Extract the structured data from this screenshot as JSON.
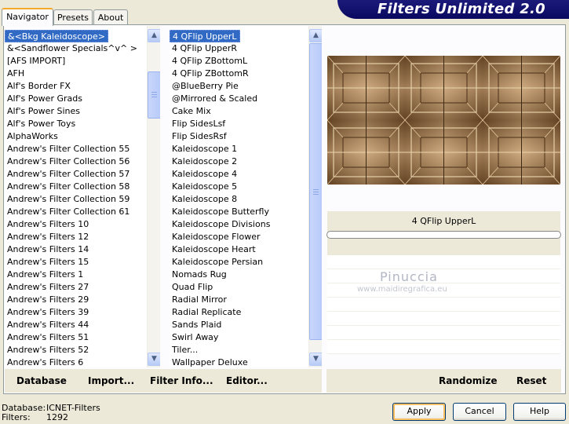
{
  "tabs": [
    "Navigator",
    "Presets",
    "About"
  ],
  "banner_title": "Filters Unlimited 2.0",
  "categories": [
    "&<Bkg Kaleidoscope>",
    "&<Sandflower Specials^v^ >",
    "[AFS IMPORT]",
    "AFH",
    "Alf's Border FX",
    "Alf's Power Grads",
    "Alf's Power Sines",
    "Alf's Power Toys",
    "AlphaWorks",
    "Andrew's Filter Collection 55",
    "Andrew's Filter Collection 56",
    "Andrew's Filter Collection 57",
    "Andrew's Filter Collection 58",
    "Andrew's Filter Collection 59",
    "Andrew's Filter Collection 61",
    "Andrew's Filters 10",
    "Andrew's Filters 12",
    "Andrew's Filters 14",
    "Andrew's Filters 15",
    "Andrew's Filters 1",
    "Andrew's Filters 27",
    "Andrew's Filters 29",
    "Andrew's Filters 39",
    "Andrew's Filters 44",
    "Andrew's Filters 51",
    "Andrew's Filters 52",
    "Andrew's Filters 6"
  ],
  "filters": [
    "4 QFlip UpperL",
    "4 QFlip UpperR",
    "4 QFlip ZBottomL",
    "4 QFlip ZBottomR",
    "@BlueBerry Pie",
    "@Mirrored & Scaled",
    "Cake Mix",
    "Flip SidesLsf",
    "Flip SidesRsf",
    "Kaleidoscope 1",
    "Kaleidoscope 2",
    "Kaleidoscope 4",
    "Kaleidoscope 5",
    "Kaleidoscope 8",
    "Kaleidoscope Butterfly",
    "Kaleidoscope Divisions",
    "Kaleidoscope Flower",
    "Kaleidoscope Heart",
    "Kaleidoscope Persian",
    "Nomads Rug",
    "Quad Flip",
    "Radial Mirror",
    "Radial Replicate",
    "Sands Plaid",
    "Swirl Away",
    "Tiler...",
    "Wallpaper Deluxe"
  ],
  "links": {
    "database": "Database",
    "import": "Import...",
    "filter_info": "Filter Info...",
    "editor": "Editor...",
    "randomize": "Randomize",
    "reset": "Reset"
  },
  "preview": {
    "filter_name": "4 QFlip UpperL",
    "progress": 0
  },
  "watermark": {
    "name": "Pinuccia",
    "site": "www.maidiregrafica.eu"
  },
  "status": {
    "database_label": "Database:",
    "database_value": "ICNET-Filters",
    "filters_label": "Filters:",
    "filters_value": "1292"
  },
  "buttons": {
    "apply": "Apply",
    "cancel": "Cancel",
    "help": "Help"
  },
  "icons": {
    "scroll_up": "up-arrow-icon",
    "scroll_down": "down-arrow-icon",
    "grip": "scroll-grip-icon"
  },
  "colors": {
    "selection": "#316ac5",
    "banner": "#0a0960",
    "preview_base": "#6b4a28"
  }
}
